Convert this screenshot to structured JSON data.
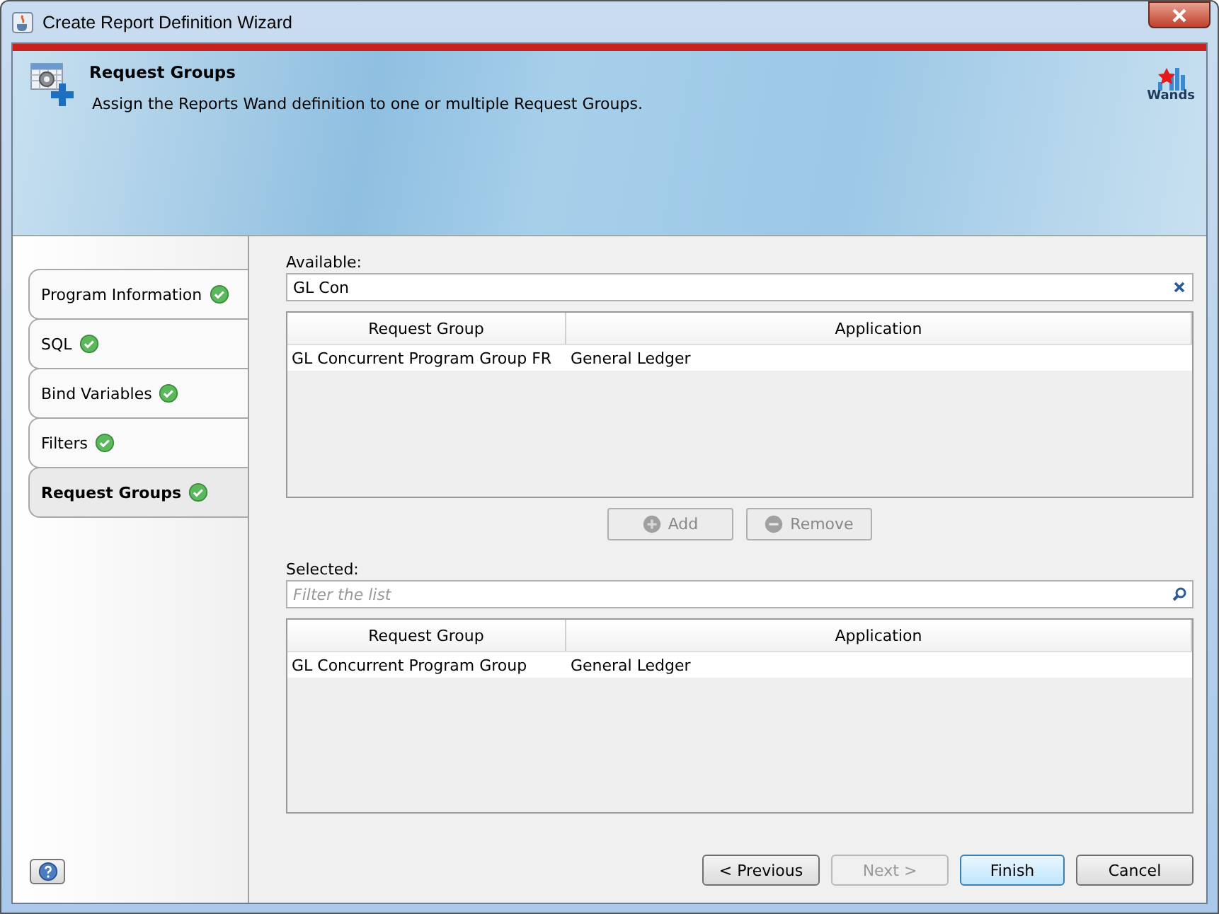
{
  "window": {
    "title": "Create Report Definition Wizard"
  },
  "header": {
    "title": "Request Groups",
    "description": "Assign the Reports Wand definition to one or multiple Request Groups.",
    "logo_text": "Wands"
  },
  "steps": [
    {
      "label": "Program Information",
      "completed": true,
      "selected": false
    },
    {
      "label": "SQL",
      "completed": true,
      "selected": false
    },
    {
      "label": "Bind Variables",
      "completed": true,
      "selected": false
    },
    {
      "label": "Filters",
      "completed": true,
      "selected": false
    },
    {
      "label": "Request Groups",
      "completed": true,
      "selected": true
    }
  ],
  "available": {
    "label": "Available:",
    "search_value": "GL Con",
    "columns": [
      "Request Group",
      "Application"
    ],
    "rows": [
      [
        "GL Concurrent Program Group FR",
        "General Ledger"
      ]
    ]
  },
  "actions": [
    {
      "label": "Add",
      "kind": "plus",
      "disabled": true
    },
    {
      "label": "Remove",
      "kind": "minus",
      "disabled": true
    }
  ],
  "selected_list": {
    "label": "Selected:",
    "filter_placeholder": "Filter the list",
    "columns": [
      "Request Group",
      "Application"
    ],
    "rows": [
      [
        "GL Concurrent Program Group",
        "General Ledger"
      ]
    ]
  },
  "buttons": [
    {
      "label": "< Previous",
      "disabled": false,
      "default": false
    },
    {
      "label": "Next >",
      "disabled": true,
      "default": false
    },
    {
      "label": "Finish",
      "disabled": false,
      "default": true
    },
    {
      "label": "Cancel",
      "disabled": false,
      "default": false
    }
  ]
}
